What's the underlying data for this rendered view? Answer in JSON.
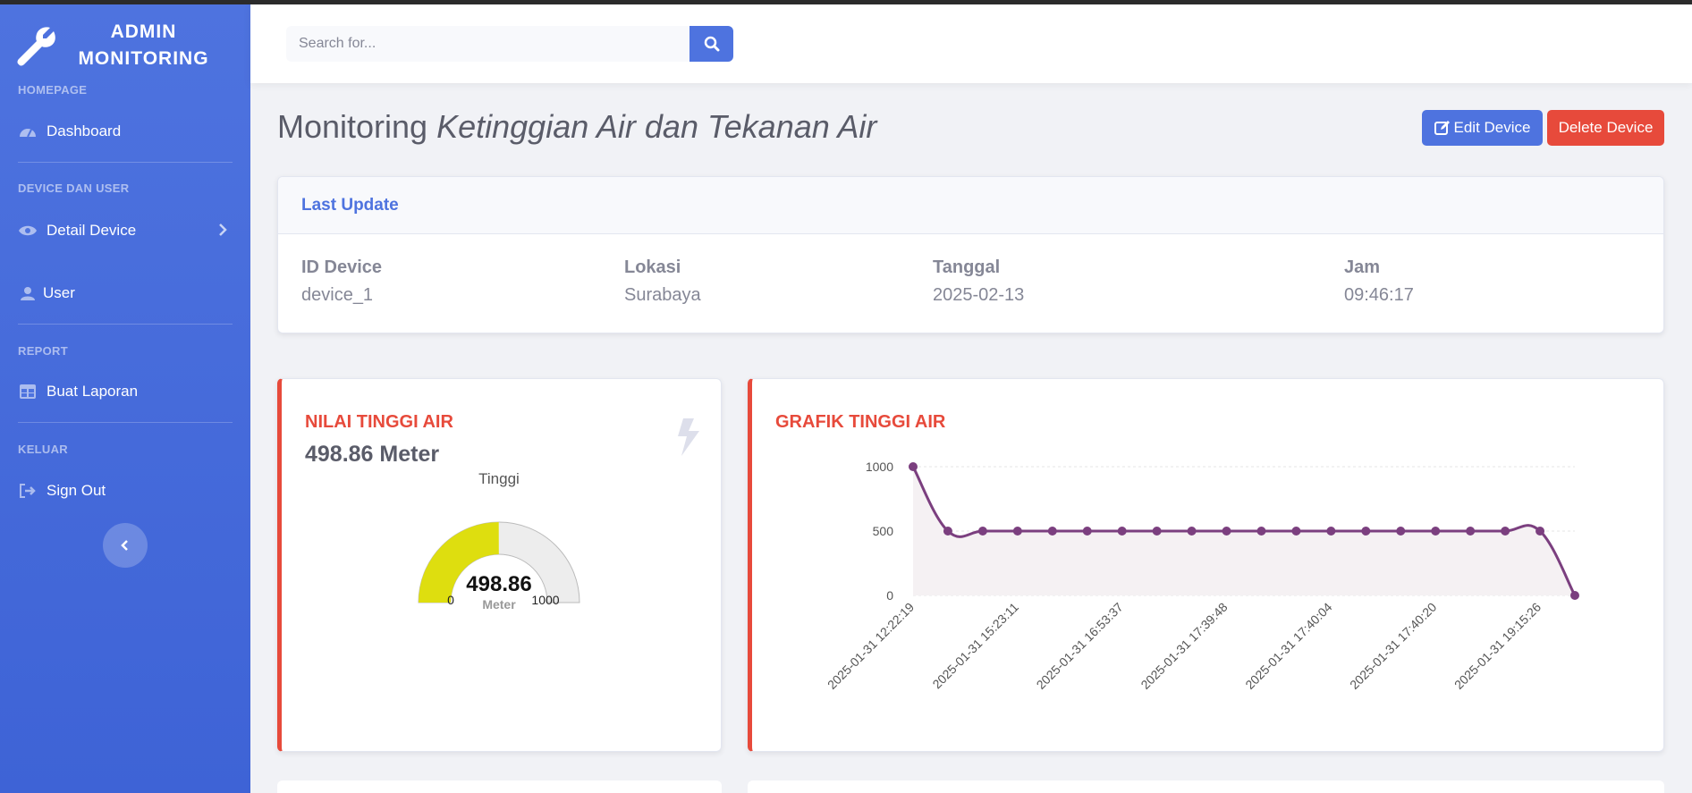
{
  "sidebar": {
    "brand_line1": "ADMIN",
    "brand_line2": "MONITORING",
    "sections": {
      "homepage": "HOMEPAGE",
      "device_user": "DEVICE DAN USER",
      "report": "REPORT",
      "logout": "KELUAR"
    },
    "items": {
      "dashboard": "Dashboard",
      "detail_device": "Detail Device",
      "user": "User",
      "buat_laporan": "Buat Laporan",
      "sign_out": "Sign Out"
    }
  },
  "topbar": {
    "search_placeholder": "Search for..."
  },
  "page": {
    "title_plain": "Monitoring ",
    "title_italic": "Ketinggian Air dan Tekanan Air",
    "edit_label": "Edit Device",
    "delete_label": "Delete Device"
  },
  "last_update": {
    "title": "Last Update",
    "fields": [
      {
        "label": "ID Device",
        "value": "device_1"
      },
      {
        "label": "Lokasi",
        "value": "Surabaya"
      },
      {
        "label": "Tanggal",
        "value": "2025-02-13"
      },
      {
        "label": "Jam",
        "value": "09:46:17"
      }
    ]
  },
  "gauge_card": {
    "title": "NILAI TINGGI AIR",
    "value_text": "498.86 Meter",
    "gauge_title": "Tinggi",
    "gauge_value": "498.86",
    "gauge_unit": "Meter",
    "gauge_min": "0",
    "gauge_max": "1000",
    "gauge_fraction": 0.49886,
    "fill_color": "#dede0f",
    "empty_color": "#ededed"
  },
  "chart_card": {
    "title": "GRAFIK TINGGI AIR"
  },
  "chart_data": {
    "type": "area",
    "xlabel": "",
    "ylabel": "",
    "ylim": [
      0,
      1000
    ],
    "yticks": [
      0,
      500,
      1000
    ],
    "x_tick_labels": [
      "2025-01-31 12:22:19",
      "2025-01-31 15:23:11",
      "2025-01-31 16:53:37",
      "2025-01-31 17:39:48",
      "2025-01-31 17:40:04",
      "2025-01-31 17:40:20",
      "2025-01-31 19:15:26"
    ],
    "series": [
      {
        "values": [
          1000,
          500,
          500,
          500,
          500,
          500,
          500,
          500,
          500,
          500,
          500,
          500,
          500,
          500,
          500,
          500,
          500,
          500,
          500,
          0
        ]
      }
    ],
    "line_color": "#7b3f7f",
    "fill_color": "#f5f1f3",
    "grid": true
  }
}
